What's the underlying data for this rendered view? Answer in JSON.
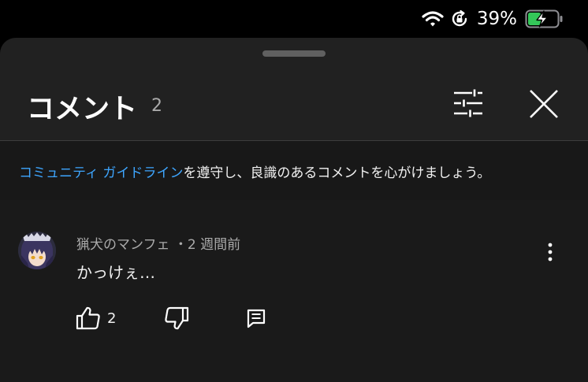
{
  "status_bar": {
    "battery_percent": "39%",
    "icons": [
      "wifi-icon",
      "rotation-lock-icon",
      "battery-charging-icon"
    ]
  },
  "sheet": {
    "title": "コメント",
    "count": "2",
    "header_icons": [
      "filter-sort-icon",
      "close-icon"
    ]
  },
  "guideline": {
    "link_text": "コミュニティ ガイドライン",
    "rest_text": "を遵守し、良識のあるコメントを心がけましょう。"
  },
  "comments": [
    {
      "author": "猟犬のマンフェ",
      "separator": "・",
      "time": "2 週間前",
      "text": "かっけぇ…",
      "likes": "2"
    }
  ],
  "colors": {
    "sheet_bg": "#212121",
    "guideline_bg": "#181818",
    "link": "#3ea6ff",
    "battery_fill": "#34c759"
  }
}
